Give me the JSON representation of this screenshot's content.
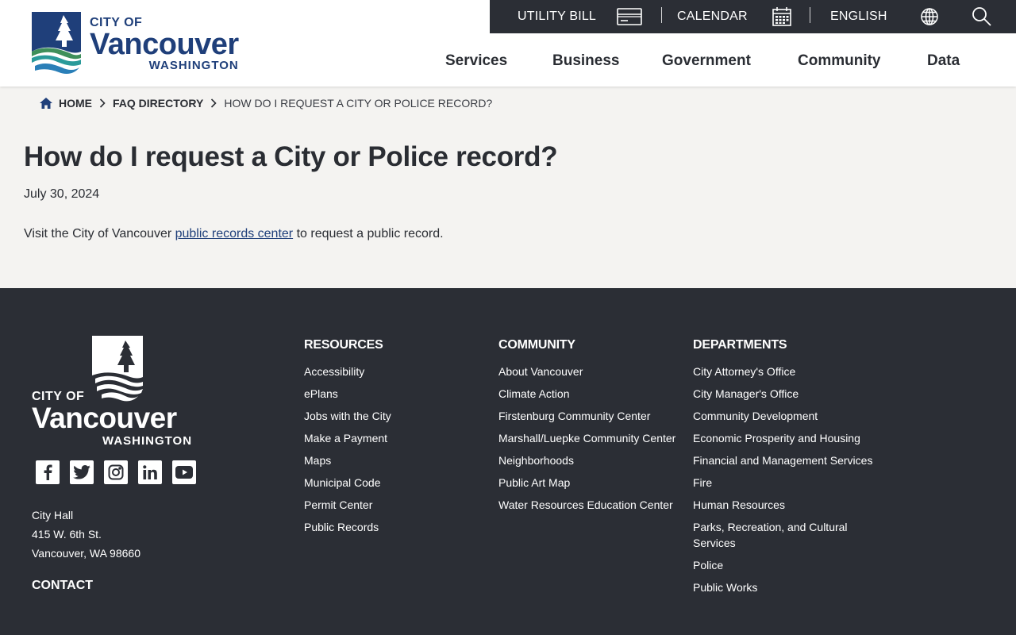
{
  "header": {
    "logo": {
      "city_of": "CITY OF",
      "name": "Vancouver",
      "state": "WASHINGTON"
    },
    "utility": {
      "utility_bill": "UTILITY BILL",
      "calendar": "CALENDAR",
      "language": "ENGLISH",
      "icons": [
        "bill-icon",
        "calendar-icon",
        "globe-icon",
        "search-icon"
      ]
    },
    "nav": [
      "Services",
      "Business",
      "Government",
      "Community",
      "Data"
    ]
  },
  "breadcrumb": {
    "home": "HOME",
    "faq": "FAQ DIRECTORY",
    "current": "HOW DO I REQUEST A CITY OR POLICE RECORD?"
  },
  "main": {
    "title": "How do I request a City or Police record?",
    "date": "July 30, 2024",
    "body_before": "Visit the City of Vancouver ",
    "body_link": "public records center",
    "body_after": " to request a public record."
  },
  "footer": {
    "logo": {
      "city_of": "CITY OF",
      "name": "Vancouver",
      "state": "WASHINGTON"
    },
    "social_icons": [
      "facebook-icon",
      "twitter-icon",
      "instagram-icon",
      "linkedin-icon",
      "youtube-icon"
    ],
    "address": [
      "City Hall",
      "415 W. 6th St.",
      "Vancouver, WA 98660"
    ],
    "contact": "CONTACT",
    "columns": [
      {
        "heading": "RESOURCES",
        "items": [
          "Accessibility",
          "ePlans",
          "Jobs with the City",
          "Make a Payment",
          "Maps",
          "Municipal Code",
          "Permit Center",
          "Public Records"
        ]
      },
      {
        "heading": "COMMUNITY",
        "items": [
          "About Vancouver",
          "Climate Action",
          "Firstenburg Community Center",
          "Marshall/Luepke Community Center",
          "Neighborhoods",
          "Public Art Map",
          "Water Resources Education Center"
        ]
      },
      {
        "heading": "DEPARTMENTS",
        "items": [
          "City Attorney's Office",
          "City Manager's Office",
          "Community Development",
          "Economic Prosperity and Housing",
          "Financial and Management Services",
          "Fire",
          "Human Resources",
          "Parks, Recreation, and Cultural Services",
          "Police",
          "Public Works"
        ]
      }
    ]
  },
  "colors": {
    "brand_blue": "#1f3f7a",
    "dark": "#2b2e35",
    "page_bg": "#f4f3f1",
    "teal": "#2a9a9a",
    "green": "#3f8f5a"
  }
}
